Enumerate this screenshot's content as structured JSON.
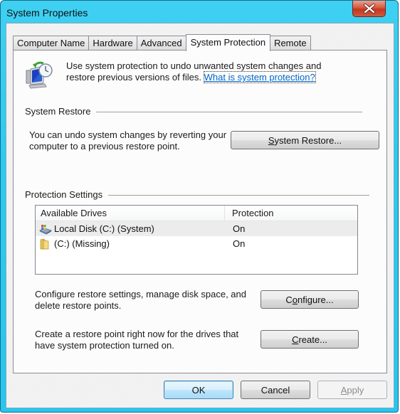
{
  "window": {
    "title": "System Properties",
    "close_icon": "close-icon"
  },
  "tabs": [
    {
      "label": "Computer Name",
      "active": false
    },
    {
      "label": "Hardware",
      "active": false
    },
    {
      "label": "Advanced",
      "active": false
    },
    {
      "label": "System Protection",
      "active": true
    },
    {
      "label": "Remote",
      "active": false
    }
  ],
  "intro": {
    "icon": "system-restore-icon",
    "text": "Use system protection to undo unwanted system changes and restore previous versions of files.",
    "link": "What is system protection?"
  },
  "system_restore": {
    "label": "System Restore",
    "description": "You can undo system changes by reverting your computer to a previous restore point.",
    "button_mnemonic": "S",
    "button_rest": "ystem Restore..."
  },
  "protection_settings": {
    "label": "Protection Settings",
    "columns": [
      "Available Drives",
      "Protection"
    ],
    "drives": [
      {
        "name": "Local Disk (C:) (System)",
        "protection": "On",
        "icon": "system-drive-icon",
        "selected": true
      },
      {
        "name": "(C:) (Missing)",
        "protection": "On",
        "icon": "folder-icon",
        "selected": false
      }
    ],
    "configure_description": "Configure restore settings, manage disk space, and delete restore points.",
    "configure_pre": "C",
    "configure_mnemonic": "o",
    "configure_rest": "nfigure...",
    "create_description": "Create a restore point right now for the drives that have system protection turned on.",
    "create_mnemonic": "C",
    "create_rest": "reate..."
  },
  "footer": {
    "ok": "OK",
    "cancel": "Cancel",
    "apply_mnemonic": "A",
    "apply_rest": "pply"
  }
}
